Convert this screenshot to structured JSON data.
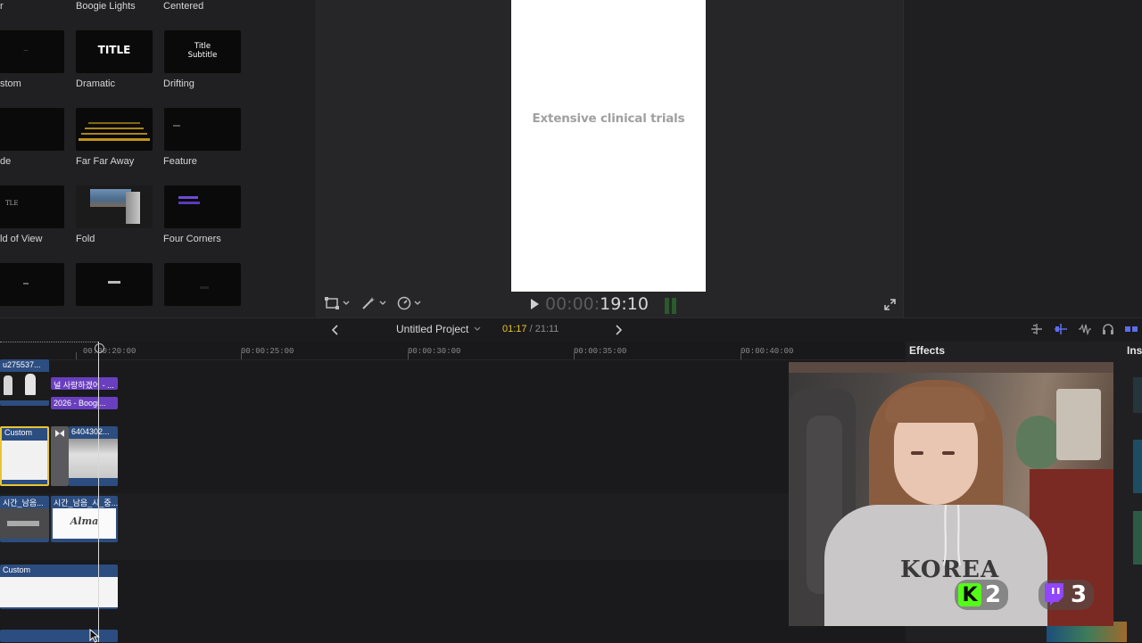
{
  "browser": {
    "row0": [
      "Boogie Lights",
      "Centered"
    ],
    "tiles": [
      {
        "label": "stom",
        "thumb": ""
      },
      {
        "label": "Dramatic",
        "thumb": "TITLE"
      },
      {
        "label": "Drifting",
        "thumb_line1": "Title",
        "thumb_line2": "Subtitle"
      },
      {
        "label": "de",
        "thumb": ""
      },
      {
        "label": "Far Far Away",
        "thumb": ""
      },
      {
        "label": "Feature",
        "thumb": ""
      },
      {
        "label": "ld of View",
        "thumb": ""
      },
      {
        "label": "Fold",
        "thumb": ""
      },
      {
        "label": "Four Corners",
        "thumb": ""
      }
    ]
  },
  "viewer": {
    "frame_text": "Extensive clinical trials",
    "timecode_dim": "00:00:",
    "timecode": "19:10"
  },
  "timeline_header": {
    "project_name": "Untitled Project",
    "position": "01:17",
    "duration": "21:11",
    "separator": " / ",
    "effects_title": "Effects",
    "inspector_label": "Ins"
  },
  "ruler": [
    "00:00:20:00",
    "00:00:25:00",
    "00:00:30:00",
    "00:00:35:00",
    "00:00:40:00"
  ],
  "clips": {
    "c1": "u275537...",
    "title1": "널 사랑하겠어 - ...",
    "title2": "2026 - Boogi...",
    "custom1": "Custom",
    "clip2": "6404302...",
    "audio1": "시간_남음...",
    "audio2": "시간_남음_시_중...",
    "alma": "Alma",
    "custom2": "Custom"
  },
  "stream_overlay": {
    "kick_count": "2",
    "twitch_count": "3"
  },
  "colors": {
    "accent_yellow": "#e8c530",
    "title_purple": "#6a3fbf",
    "clip_blue": "#2c4d80",
    "playhead": "#d8d8d8",
    "kick_green": "#53fc18",
    "twitch_purple": "#9146ff"
  }
}
